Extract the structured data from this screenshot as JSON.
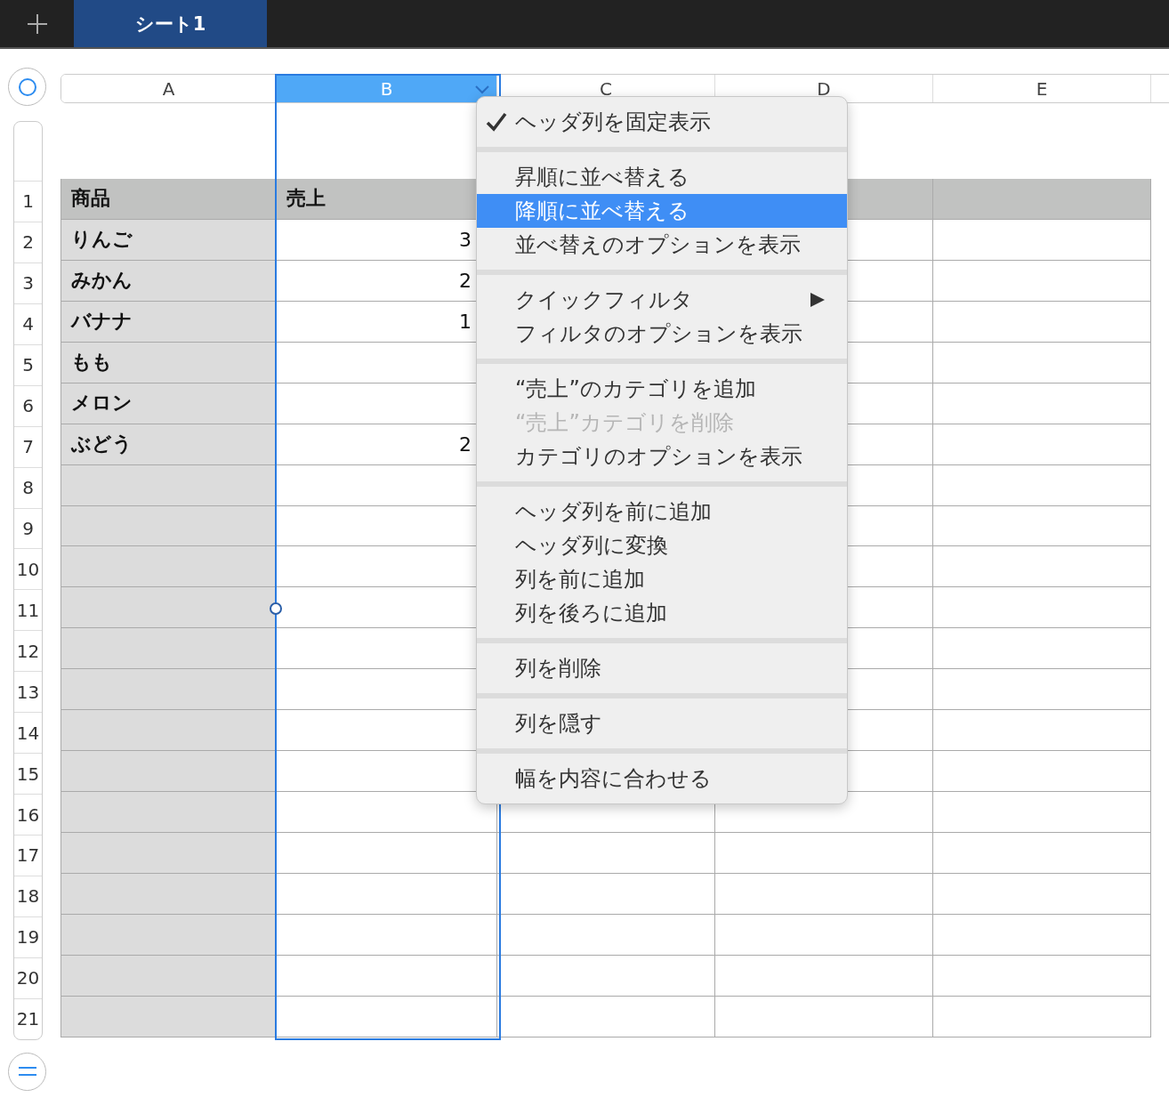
{
  "top_bar": {
    "tabs": [
      {
        "label": "シート1",
        "selected": true
      }
    ]
  },
  "column_headers": [
    {
      "label": "A",
      "selected": false
    },
    {
      "label": "B",
      "selected": true
    },
    {
      "label": "C",
      "selected": false
    },
    {
      "label": "D",
      "selected": false
    },
    {
      "label": "E",
      "selected": false
    }
  ],
  "row_numbers": [
    "1",
    "2",
    "3",
    "4",
    "5",
    "6",
    "7",
    "8",
    "9",
    "10",
    "11",
    "12",
    "13",
    "14",
    "15",
    "16",
    "17",
    "18",
    "19",
    "20",
    "21"
  ],
  "table": {
    "header": [
      "商品",
      "売上"
    ],
    "rows": [
      {
        "name": "りんご",
        "value": "3"
      },
      {
        "name": "みかん",
        "value": "2"
      },
      {
        "name": "バナナ",
        "value": "1"
      },
      {
        "name": "もも"
      },
      {
        "name": "メロン"
      },
      {
        "name": "ぶどう",
        "value": "2"
      }
    ]
  },
  "context_menu": {
    "groups": [
      [
        {
          "label": "ヘッダ列を固定表示",
          "kind": "plain",
          "checked": true,
          "selected": false,
          "disabled": false
        }
      ],
      [
        {
          "label": "昇順に並べ替える",
          "kind": "plain",
          "checked": false,
          "selected": false,
          "disabled": false
        },
        {
          "label": "降順に並べ替える",
          "kind": "plain",
          "checked": false,
          "selected": true,
          "disabled": false
        },
        {
          "label": "並べ替えのオプションを表示",
          "kind": "plain",
          "checked": false,
          "selected": false,
          "disabled": false
        }
      ],
      [
        {
          "label": "クイックフィルタ",
          "kind": "submenu",
          "checked": false,
          "selected": false,
          "disabled": false
        },
        {
          "label": "フィルタのオプションを表示",
          "kind": "plain",
          "checked": false,
          "selected": false,
          "disabled": false
        }
      ],
      [
        {
          "label": "“売上”のカテゴリを追加",
          "kind": "plain",
          "checked": false,
          "selected": false,
          "disabled": false
        },
        {
          "label": "“売上”カテゴリを削除",
          "kind": "plain",
          "checked": false,
          "selected": false,
          "disabled": true
        },
        {
          "label": "カテゴリのオプションを表示",
          "kind": "plain",
          "checked": false,
          "selected": false,
          "disabled": false
        }
      ],
      [
        {
          "label": "ヘッダ列を前に追加",
          "kind": "plain",
          "checked": false,
          "selected": false,
          "disabled": false
        },
        {
          "label": "ヘッダ列に変換",
          "kind": "plain",
          "checked": false,
          "selected": false,
          "disabled": false
        },
        {
          "label": "列を前に追加",
          "kind": "plain",
          "checked": false,
          "selected": false,
          "disabled": false
        },
        {
          "label": "列を後ろに追加",
          "kind": "plain",
          "checked": false,
          "selected": false,
          "disabled": false
        }
      ],
      [
        {
          "label": "列を削除",
          "kind": "plain",
          "checked": false,
          "selected": false,
          "disabled": false
        }
      ],
      [
        {
          "label": "列を隠す",
          "kind": "plain",
          "checked": false,
          "selected": false,
          "disabled": false
        }
      ],
      [
        {
          "label": "幅を内容に合わせる",
          "kind": "plain",
          "checked": false,
          "selected": false,
          "disabled": false
        }
      ]
    ]
  }
}
